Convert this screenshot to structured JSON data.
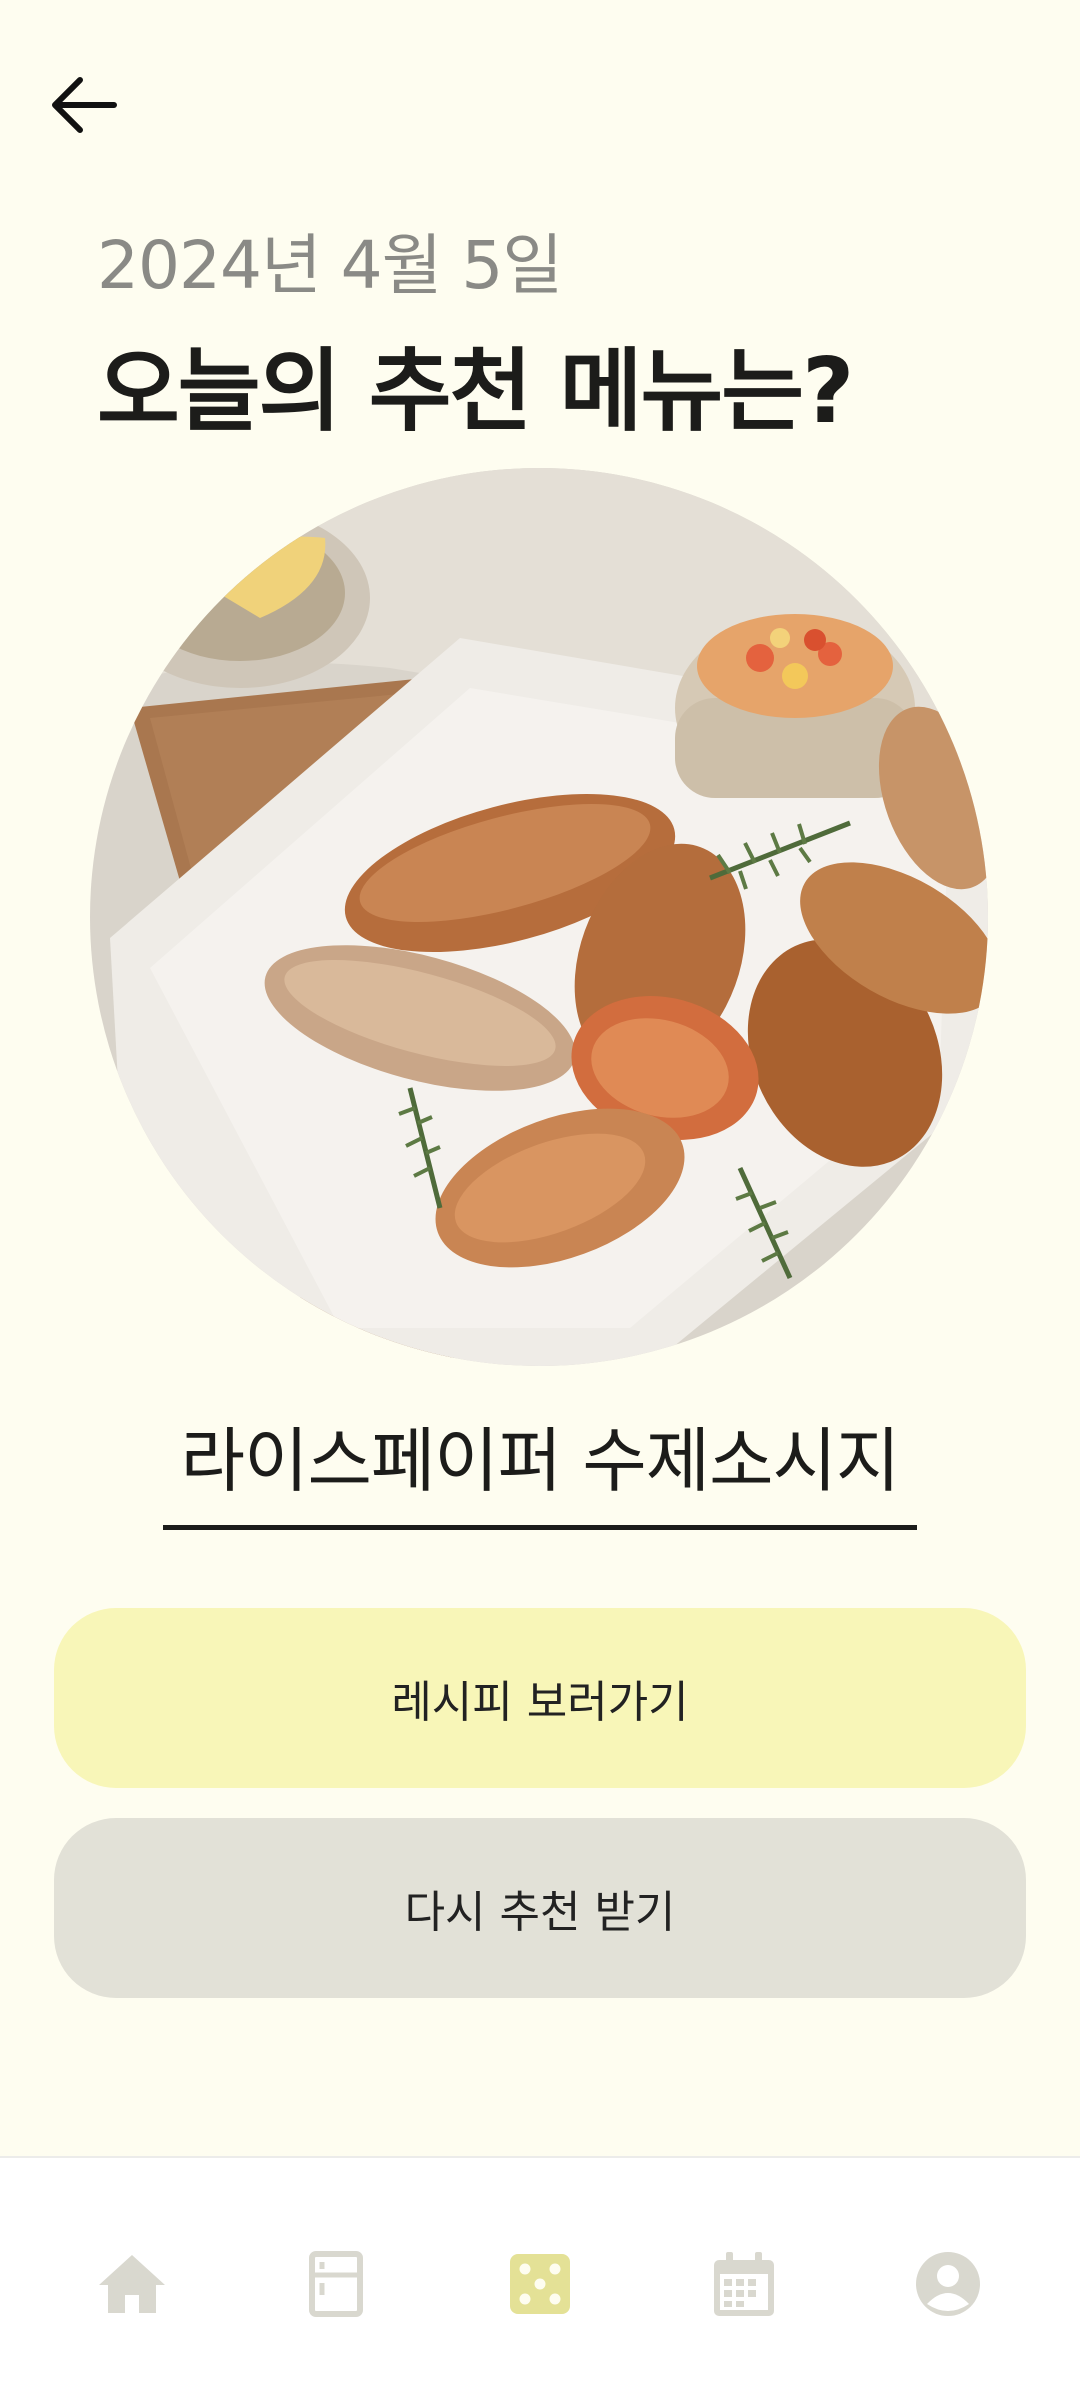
{
  "header": {
    "back_icon": "arrow-left-icon",
    "date": "2024년 4월 5일",
    "title": "오늘의 추천 메뉴는?"
  },
  "recommendation": {
    "image_alt": "라이스페이퍼 수제소시지",
    "menu_name": "라이스페이퍼 수제소시지"
  },
  "actions": {
    "recipe_label": "레시피 보러가기",
    "retry_label": "다시 추천 받기"
  },
  "bottom_nav": {
    "items": [
      {
        "icon": "home-icon",
        "active": false
      },
      {
        "icon": "fridge-icon",
        "active": false
      },
      {
        "icon": "dice-icon",
        "active": true
      },
      {
        "icon": "calendar-icon",
        "active": false
      },
      {
        "icon": "profile-icon",
        "active": false
      }
    ]
  },
  "colors": {
    "background": "#fefdf0",
    "primary_button": "#f8f6b8",
    "secondary_button": "#e2e1d7",
    "nav_inactive": "#d9d8cf",
    "nav_active": "#e4e196"
  }
}
